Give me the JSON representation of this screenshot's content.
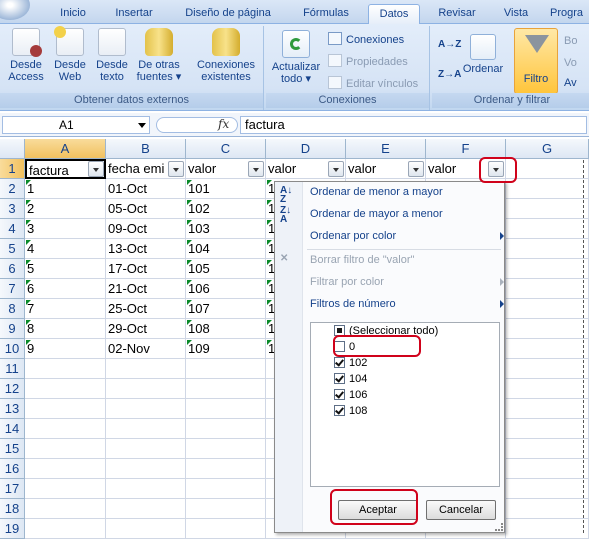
{
  "tabs": [
    "Inicio",
    "Insertar",
    "Diseño de página",
    "Fórmulas",
    "Datos",
    "Revisar",
    "Vista",
    "Progra"
  ],
  "active_tab": "Datos",
  "ribbon": {
    "group_external": {
      "label": "Obtener datos externos",
      "buttons": [
        "Desde Access",
        "Desde Web",
        "Desde texto",
        "De otras fuentes ▾"
      ],
      "existing": "Conexiones existentes"
    },
    "group_connections": {
      "label": "Conexiones",
      "refresh": "Actualizar todo ▾",
      "items": [
        "Conexiones",
        "Propiedades",
        "Editar vínculos"
      ]
    },
    "group_sort": {
      "label": "Ordenar y filtrar",
      "sort_az": "A→Z",
      "sort_za": "Z→A",
      "sort": "Ordenar",
      "filter": "Filtro",
      "side": [
        "Bo",
        "Vo",
        "Av"
      ]
    }
  },
  "formula_bar": {
    "cell_ref": "A1",
    "fx": "fx",
    "value": "factura"
  },
  "columns": [
    "A",
    "B",
    "C",
    "D",
    "E",
    "F",
    "G"
  ],
  "rows": [
    "1",
    "2",
    "3",
    "4",
    "5",
    "6",
    "7",
    "8",
    "9",
    "10",
    "11",
    "12",
    "13",
    "14",
    "15",
    "16",
    "17",
    "18",
    "19"
  ],
  "headers": [
    "factura",
    "fecha emi",
    "valor",
    "valor",
    "valor",
    "valor"
  ],
  "data": [
    [
      "1",
      "01-Oct",
      "101",
      "1"
    ],
    [
      "2",
      "05-Oct",
      "102",
      "1"
    ],
    [
      "3",
      "09-Oct",
      "103",
      "1"
    ],
    [
      "4",
      "13-Oct",
      "104",
      "1"
    ],
    [
      "5",
      "17-Oct",
      "105",
      "1"
    ],
    [
      "6",
      "21-Oct",
      "106",
      "1"
    ],
    [
      "7",
      "25-Oct",
      "107",
      "1"
    ],
    [
      "8",
      "29-Oct",
      "108",
      "1"
    ],
    [
      "9",
      "02-Nov",
      "109",
      "1"
    ]
  ],
  "filter_menu": {
    "sort_asc": "Ordenar de menor a mayor",
    "sort_desc": "Ordenar de mayor a menor",
    "sort_color": "Ordenar por color",
    "clear_filter": "Borrar filtro de \"valor\"",
    "filter_color": "Filtrar por color",
    "number_filters": "Filtros de número",
    "list": [
      {
        "label": "(Seleccionar todo)",
        "state": "partial"
      },
      {
        "label": "0",
        "state": "off"
      },
      {
        "label": "102",
        "state": "on"
      },
      {
        "label": "104",
        "state": "on"
      },
      {
        "label": "106",
        "state": "on"
      },
      {
        "label": "108",
        "state": "on"
      }
    ],
    "ok": "Aceptar",
    "cancel": "Cancelar"
  },
  "colors": {
    "highlight": "#d0021b",
    "accent": "#ffc53c"
  }
}
